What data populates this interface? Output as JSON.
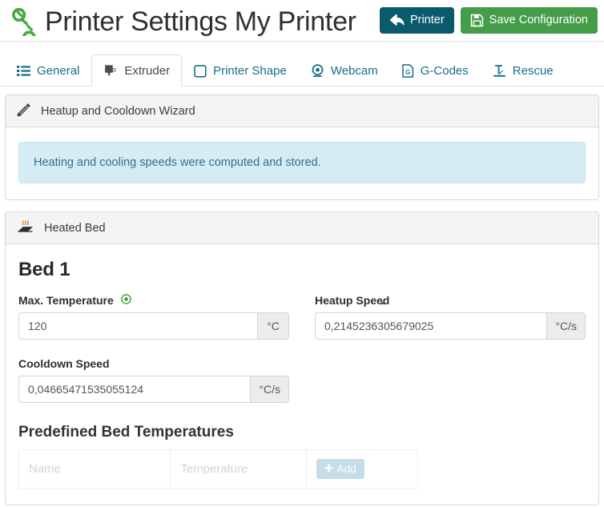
{
  "header": {
    "logo_icon": "chain-link-icon",
    "title": "Printer Settings My Printer",
    "buttons": [
      {
        "id": "printer",
        "label": "Printer",
        "icon": "back-arrow-icon",
        "color": "#0a5a6b"
      },
      {
        "id": "save",
        "label": "Save Configuration",
        "icon": "floppy-save-icon",
        "color": "#449d48"
      }
    ]
  },
  "tabs": [
    {
      "id": "general",
      "label": "General",
      "icon": "list-icon",
      "active": false
    },
    {
      "id": "extruder",
      "label": "Extruder",
      "icon": "extruder-icon",
      "active": true
    },
    {
      "id": "printer-shape",
      "label": "Printer Shape",
      "icon": "square-icon",
      "active": false
    },
    {
      "id": "webcam",
      "label": "Webcam",
      "icon": "webcam-icon",
      "active": false
    },
    {
      "id": "g-codes",
      "label": "G-Codes",
      "icon": "file-gcode-icon",
      "active": false
    },
    {
      "id": "rescue",
      "label": "Rescue",
      "icon": "rescue-anchor-icon",
      "active": false
    }
  ],
  "wizard_panel": {
    "icon": "magic-wand-icon",
    "title": "Heatup and Cooldown Wizard",
    "alert": {
      "text": "Heating and cooling speeds were computed and stored.",
      "bg": "#d6ecf5",
      "fg": "#31708f"
    }
  },
  "bed_panel": {
    "icon": "heated-bed-icon",
    "title": "Heated Bed",
    "section_title": "Bed 1",
    "fields": {
      "max_temperature": {
        "label": "Max. Temperature",
        "info_icon": "green-target-icon",
        "info_color": "#3c9c3c",
        "value": "120",
        "unit": "°C"
      },
      "heatup_speed": {
        "label": "Heatup Speed",
        "value": "0,2145236305679025",
        "unit": "°C/s"
      },
      "cooldown_speed": {
        "label": "Cooldown Speed",
        "value": "0,04665471535055124",
        "unit": "°C/s"
      }
    },
    "table": {
      "title": "Predefined Bed Temperatures",
      "columns": [
        "Name",
        "Temperature"
      ],
      "add_label": "Add",
      "add_icon": "plus-icon",
      "rows": []
    }
  }
}
